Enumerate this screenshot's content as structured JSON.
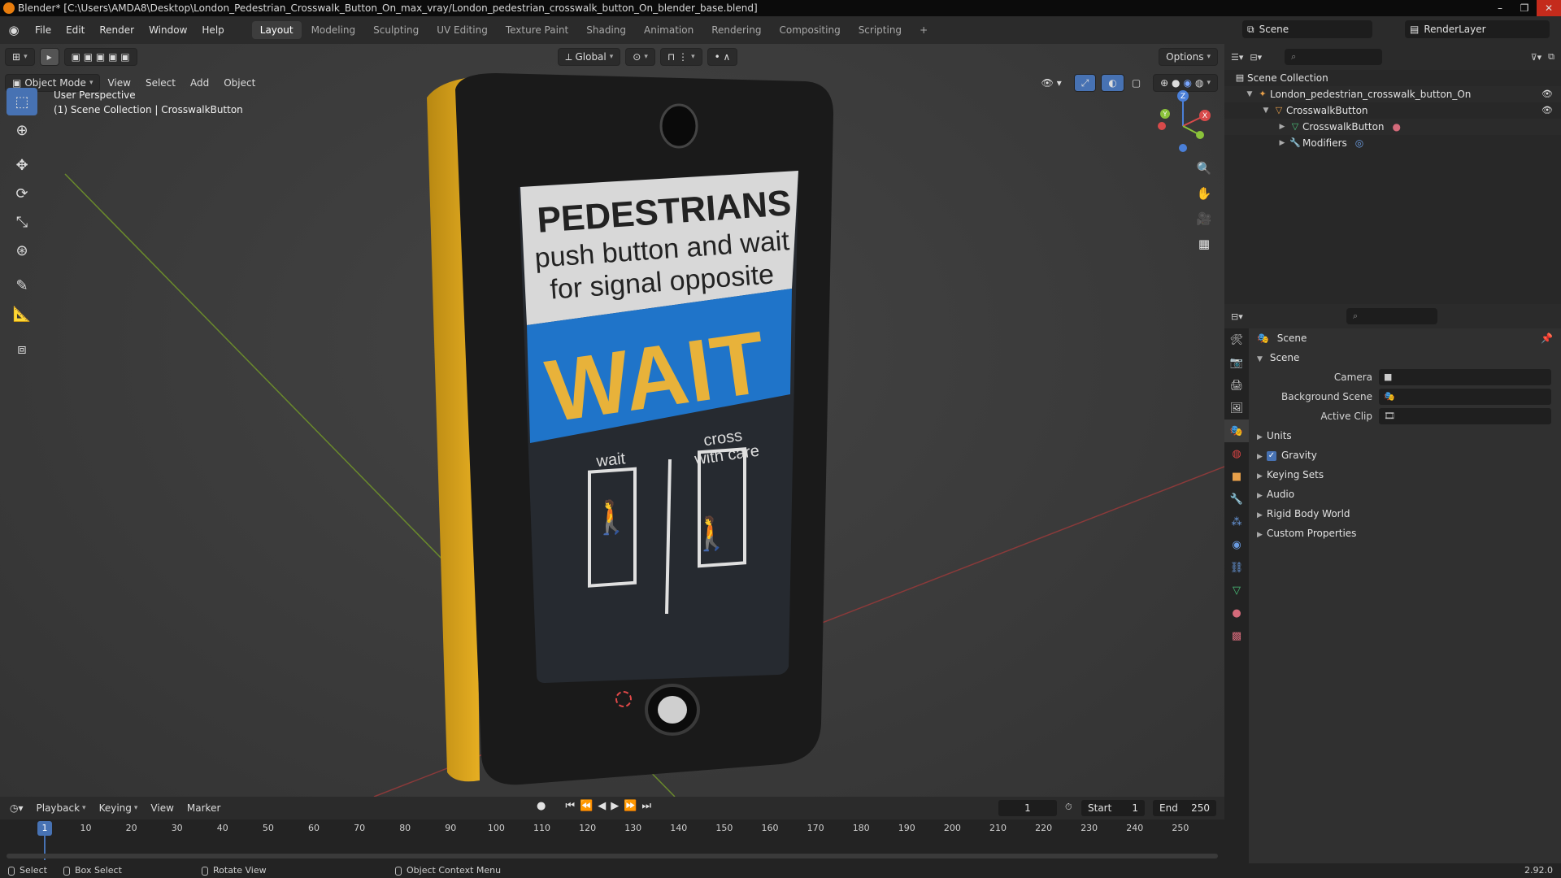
{
  "window": {
    "title": "Blender* [C:\\Users\\AMDA8\\Desktop\\London_Pedestrian_Crosswalk_Button_On_max_vray/London_pedestrian_crosswalk_button_On_blender_base.blend]",
    "minimize": "–",
    "maximize": "❐",
    "close": "✕"
  },
  "menubar": {
    "menus": [
      "File",
      "Edit",
      "Render",
      "Window",
      "Help"
    ],
    "workspaces": [
      "Layout",
      "Modeling",
      "Sculpting",
      "UV Editing",
      "Texture Paint",
      "Shading",
      "Animation",
      "Rendering",
      "Compositing",
      "Scripting"
    ],
    "active_workspace": "Layout",
    "add_workspace": "+",
    "scene_name": "Scene",
    "view_layer": "RenderLayer"
  },
  "viewport": {
    "orientation": "Global",
    "options_label": "Options",
    "mode": "Object Mode",
    "menus": [
      "View",
      "Select",
      "Add",
      "Object"
    ],
    "overlay_line1": "User Perspective",
    "overlay_line2": "(1) Scene Collection | CrosswalkButton"
  },
  "device_sign": {
    "heading": "PEDESTRIANS",
    "line2": "push button and wait",
    "line3": "for signal opposite",
    "wait_panel": "WAIT",
    "left_label": "wait",
    "right_label1": "cross",
    "right_label2": "with care"
  },
  "gizmo": {
    "z": "Z",
    "y": "Y",
    "x": "X"
  },
  "outliner": {
    "search_placeholder": "",
    "rows": [
      {
        "label": "Scene Collection"
      },
      {
        "label": "London_pedestrian_crosswalk_button_On"
      },
      {
        "label": "CrosswalkButton"
      },
      {
        "label": "CrosswalkButton"
      },
      {
        "label": "Modifiers"
      }
    ]
  },
  "properties": {
    "context": "Scene",
    "section": "Scene",
    "fields": [
      {
        "label": "Camera",
        "value": ""
      },
      {
        "label": "Background Scene",
        "value": ""
      },
      {
        "label": "Active Clip",
        "value": ""
      }
    ],
    "panels": [
      "Units",
      "Gravity",
      "Keying Sets",
      "Audio",
      "Rigid Body World",
      "Custom Properties"
    ],
    "gravity_checked": true
  },
  "timeline": {
    "menus": [
      "Playback",
      "Keying",
      "View",
      "Marker"
    ],
    "current_frame": "1",
    "start_label": "Start",
    "start": "1",
    "end_label": "End",
    "end": "250",
    "ticks": [
      "1",
      "10",
      "20",
      "30",
      "40",
      "50",
      "60",
      "70",
      "80",
      "90",
      "100",
      "110",
      "120",
      "130",
      "140",
      "150",
      "160",
      "170",
      "180",
      "190",
      "200",
      "210",
      "220",
      "230",
      "240",
      "250"
    ]
  },
  "statusbar": {
    "select": "Select",
    "box_select": "Box Select",
    "rotate_view": "Rotate View",
    "context_menu": "Object Context Menu",
    "version": "2.92.0"
  },
  "colors": {
    "accent": "#4772b3",
    "wait_blue": "#1f74c9",
    "wait_text": "#e8b23a",
    "device_yellow": "#e0a81f"
  }
}
